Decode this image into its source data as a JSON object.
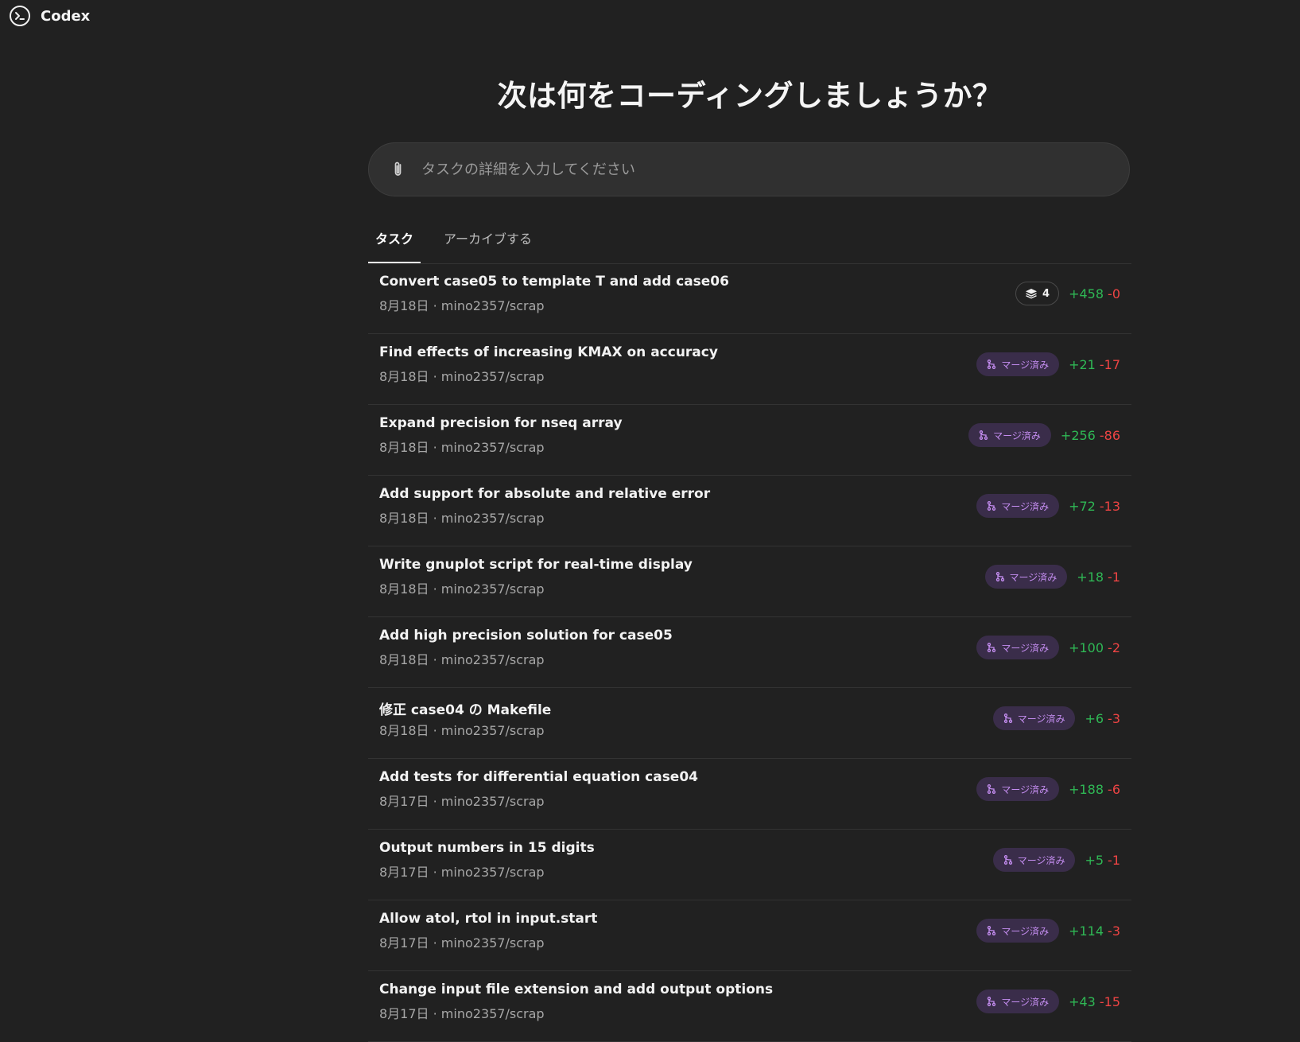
{
  "app": {
    "title": "Codex"
  },
  "headline": "次は何をコーディングしましょうか？",
  "composer": {
    "placeholder": "タスクの詳細を入力してください",
    "value": ""
  },
  "tabs": [
    {
      "label": "タスク",
      "active": true
    },
    {
      "label": "アーカイブする",
      "active": false
    }
  ],
  "colors": {
    "background": "#212121",
    "merged_badge_bg": "#3a2d4a",
    "merged_badge_text": "#c48df0",
    "additions": "#2fb855",
    "deletions": "#ef4444"
  },
  "tasks": [
    {
      "title": "Convert case05 to template T and add case06",
      "meta": "8月18日 · mino2357/scrap",
      "badge": {
        "kind": "versions",
        "icon": "layers-icon",
        "label": "4"
      },
      "additions": "+458",
      "deletions": "-0"
    },
    {
      "title": "Find effects of increasing KMAX on accuracy",
      "meta": "8月18日 · mino2357/scrap",
      "badge": {
        "kind": "merged",
        "icon": "merge-icon",
        "label": "マージ済み"
      },
      "additions": "+21",
      "deletions": "-17"
    },
    {
      "title": "Expand precision for nseq array",
      "meta": "8月18日 · mino2357/scrap",
      "badge": {
        "kind": "merged",
        "icon": "merge-icon",
        "label": "マージ済み"
      },
      "additions": "+256",
      "deletions": "-86"
    },
    {
      "title": "Add support for absolute and relative error",
      "meta": "8月18日 · mino2357/scrap",
      "badge": {
        "kind": "merged",
        "icon": "merge-icon",
        "label": "マージ済み"
      },
      "additions": "+72",
      "deletions": "-13"
    },
    {
      "title": "Write gnuplot script for real-time display",
      "meta": "8月18日 · mino2357/scrap",
      "badge": {
        "kind": "merged",
        "icon": "merge-icon",
        "label": "マージ済み"
      },
      "additions": "+18",
      "deletions": "-1"
    },
    {
      "title": "Add high precision solution for case05",
      "meta": "8月18日 · mino2357/scrap",
      "badge": {
        "kind": "merged",
        "icon": "merge-icon",
        "label": "マージ済み"
      },
      "additions": "+100",
      "deletions": "-2"
    },
    {
      "title": "修正 case04 の Makefile",
      "meta": "8月18日 · mino2357/scrap",
      "badge": {
        "kind": "merged",
        "icon": "merge-icon",
        "label": "マージ済み"
      },
      "additions": "+6",
      "deletions": "-3"
    },
    {
      "title": "Add tests for differential equation case04",
      "meta": "8月17日 · mino2357/scrap",
      "badge": {
        "kind": "merged",
        "icon": "merge-icon",
        "label": "マージ済み"
      },
      "additions": "+188",
      "deletions": "-6"
    },
    {
      "title": "Output numbers in 15 digits",
      "meta": "8月17日 · mino2357/scrap",
      "badge": {
        "kind": "merged",
        "icon": "merge-icon",
        "label": "マージ済み"
      },
      "additions": "+5",
      "deletions": "-1"
    },
    {
      "title": "Allow atol, rtol in input.start",
      "meta": "8月17日 · mino2357/scrap",
      "badge": {
        "kind": "merged",
        "icon": "merge-icon",
        "label": "マージ済み"
      },
      "additions": "+114",
      "deletions": "-3"
    },
    {
      "title": "Change input file extension and add output options",
      "meta": "8月17日 · mino2357/scrap",
      "badge": {
        "kind": "merged",
        "icon": "merge-icon",
        "label": "マージ済み"
      },
      "additions": "+43",
      "deletions": "-15"
    }
  ]
}
